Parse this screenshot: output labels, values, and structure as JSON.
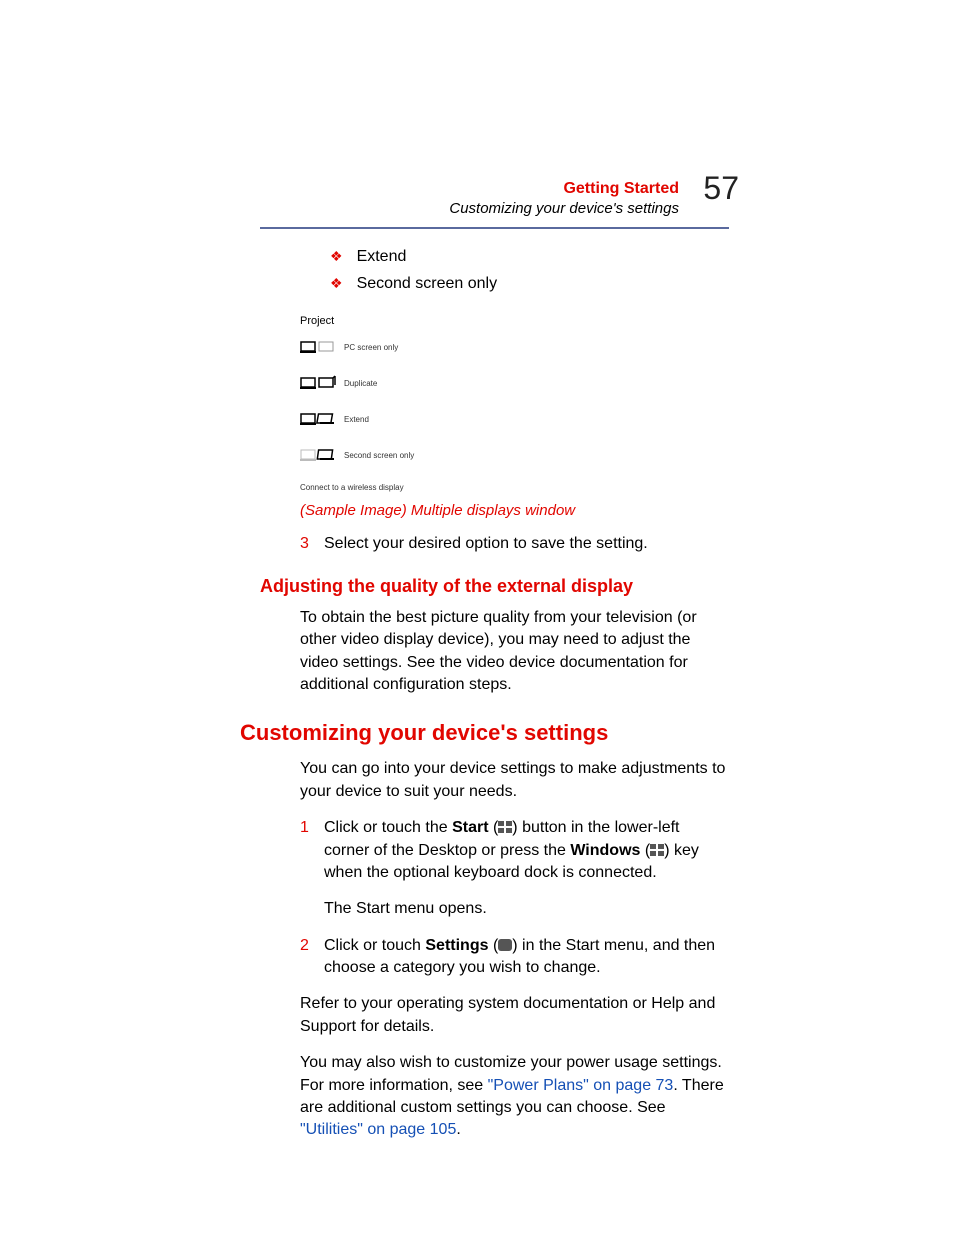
{
  "header": {
    "chapter": "Getting Started",
    "subtitle": "Customizing your device's settings",
    "page_number": "57"
  },
  "bullets": {
    "b1": "Extend",
    "b2": "Second screen only"
  },
  "figure": {
    "title": "Project",
    "opt1": "PC screen only",
    "opt2": "Duplicate",
    "opt3": "Extend",
    "opt4": "Second screen only",
    "wireless": "Connect to a wireless display"
  },
  "caption": "(Sample Image) Multiple displays window",
  "step3": {
    "num": "3",
    "text": "Select your desired option to save the setting."
  },
  "h3_adjust": "Adjusting the quality of the external display",
  "para_adjust": "To obtain the best picture quality from your television (or other video display device), you may need to adjust the video settings. See the video device documentation for additional configuration steps.",
  "h2_custom": "Customizing your device's settings",
  "para_custom_intro": "You can go into your device settings to make adjustments to your device to suit your needs.",
  "step1": {
    "num": "1",
    "pre": "Click or touch the ",
    "b1": "Start",
    "mid1": " (",
    "mid2": ") button in the lower-left corner of the Desktop or press the ",
    "b2": "Windows",
    "mid3": " (",
    "mid4": ") key when the optional keyboard dock is connected."
  },
  "para_start_opens": "The Start menu opens.",
  "step2": {
    "num": "2",
    "pre": "Click or touch ",
    "b1": "Settings",
    "mid1": " (",
    "mid2": ") in the Start menu, and then choose a category you wish to change."
  },
  "para_refer": "Refer to your operating system documentation or Help and Support for details.",
  "para_power_1": "You may also wish to customize your power usage settings. For more information, see ",
  "link_power": "\"Power Plans\" on page 73",
  "para_power_2": ". There are additional custom settings you can choose. See ",
  "link_util": "\"Utilities\" on page 105",
  "para_power_3": "."
}
